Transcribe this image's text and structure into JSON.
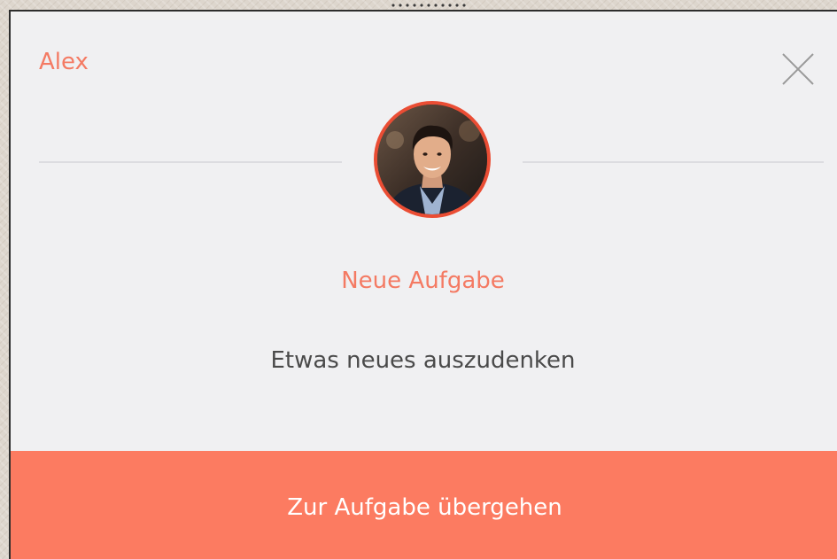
{
  "notification": {
    "sender_name": "Alex",
    "avatar_icon": "user-photo-avatar",
    "close_icon": "close-icon",
    "task_title": "Neue Aufgabe",
    "task_description": "Etwas neues auszudenken",
    "action_label": "Zur Aufgabe übergehen"
  },
  "colors": {
    "accent": "#f47a63",
    "button_background": "#fc7b61",
    "avatar_border": "#ea4d34",
    "dialog_background": "#f0f0f2",
    "text_dark": "#4a4a4a"
  }
}
